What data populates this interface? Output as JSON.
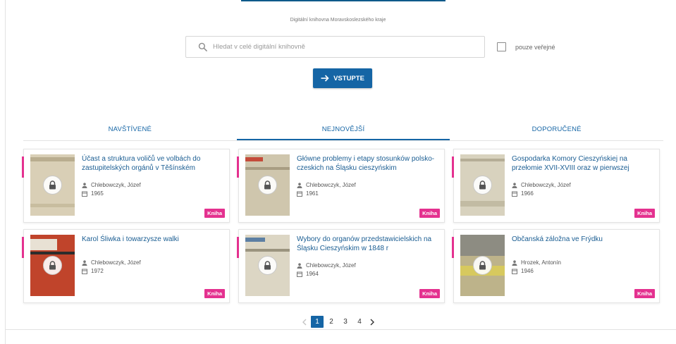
{
  "header": {
    "subtitle": "Digitální knihovna Moravskoslezského kraje"
  },
  "search": {
    "placeholder": "Hledat v celé digitální knihovně",
    "value": "",
    "public_only_label": "pouze veřejné",
    "public_only_checked": false
  },
  "enter_button": {
    "label": "VSTUPTE"
  },
  "tabs": [
    {
      "label": "NAVŠTÍVENÉ",
      "active": false
    },
    {
      "label": "NEJNOVĚJŠÍ",
      "active": true
    },
    {
      "label": "DOPORUČENÉ",
      "active": false
    }
  ],
  "cards": [
    {
      "title": "Účast a struktura voličů ve volbách do zastupitelských orgánů v Těšínském",
      "author": "Chlebowczyk, Józef",
      "year": "1965",
      "type": "Kniha",
      "locked": true,
      "cover_color": "#d9cfb6"
    },
    {
      "title": "Główne problemy i etapy stosunków polsko-czeskich na Śląsku cieszyńskim",
      "author": "Chlebowczyk, Józef",
      "year": "1961",
      "type": "Kniha",
      "locked": true,
      "cover_color": "#cfc6ad"
    },
    {
      "title": "Gospodarka Komory Cieszyńskiej na przełomie XVII-XVIII oraz w pierwszej",
      "author": "Chlebowczyk, Józef",
      "year": "1966",
      "type": "Kniha",
      "locked": true,
      "cover_color": "#d8d2be"
    },
    {
      "title": "Karol Śliwka i towarzysze walki",
      "author": "Chlebowczyk, Józef",
      "year": "1972",
      "type": "Kniha",
      "locked": true,
      "cover_color": "#c0442b"
    },
    {
      "title": "Wybory do organów przedstawicielskich na Śląsku Cieszyńskim w 1848 r",
      "author": "Chlebowczyk, Józef",
      "year": "1964",
      "type": "Kniha",
      "locked": true,
      "cover_color": "#dcd6c4"
    },
    {
      "title": "Občanská záložna ve Frýdku",
      "author": "Hrozek, Antonín",
      "year": "1946",
      "type": "Kniha",
      "locked": true,
      "cover_color": "#bdb38a"
    }
  ],
  "pagination": {
    "pages": [
      "1",
      "2",
      "3",
      "4"
    ],
    "current": "1"
  },
  "colors": {
    "primary": "#1565a5",
    "accent": "#e4318f"
  },
  "icons": {
    "search": "search-icon",
    "arrow": "arrow-right-icon",
    "lock": "lock-icon",
    "person": "person-icon",
    "calendar": "calendar-icon",
    "prev": "chevron-left-icon",
    "next": "chevron-right-icon"
  }
}
